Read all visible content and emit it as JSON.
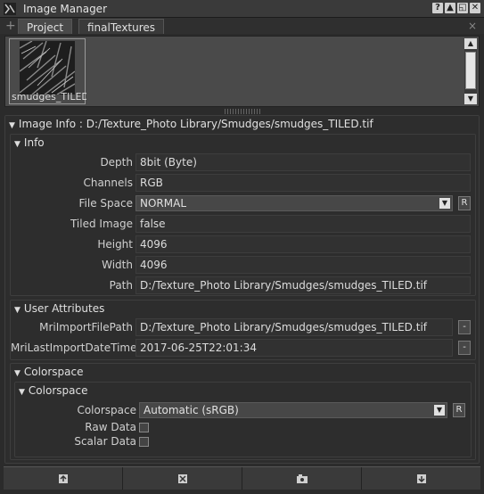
{
  "window": {
    "title": "Image Manager",
    "buttons": [
      "?",
      "▲",
      "◱",
      "✕"
    ]
  },
  "tabs": {
    "add": "+",
    "items": [
      {
        "label": "Project"
      },
      {
        "label": "finalTextures"
      }
    ],
    "close": "×"
  },
  "thumbnails": [
    {
      "label": "smudges_TILED"
    }
  ],
  "image_info": {
    "header": "Image Info : D:/Texture_Photo Library/Smudges/smudges_TILED.tif",
    "info": {
      "header": "Info",
      "depth": {
        "label": "Depth",
        "value": "8bit  (Byte)"
      },
      "channels": {
        "label": "Channels",
        "value": "RGB"
      },
      "file_space": {
        "label": "File Space",
        "value": "NORMAL",
        "reset": "R"
      },
      "tiled": {
        "label": "Tiled Image",
        "value": "false"
      },
      "height": {
        "label": "Height",
        "value": "4096"
      },
      "width": {
        "label": "Width",
        "value": "4096"
      },
      "path": {
        "label": "Path",
        "value": "D:/Texture_Photo Library/Smudges/smudges_TILED.tif"
      }
    },
    "user_attributes": {
      "header": "User Attributes",
      "import_path": {
        "label": "MriImportFilePath",
        "value": "D:/Texture_Photo Library/Smudges/smudges_TILED.tif",
        "button": "-"
      },
      "import_date": {
        "label": "MriLastImportDateTime",
        "value": "2017-06-25T22:01:34",
        "button": "-"
      }
    },
    "colorspace_outer": {
      "header": "Colorspace",
      "inner": {
        "header": "Colorspace",
        "colorspace": {
          "label": "Colorspace",
          "value": "Automatic (sRGB)",
          "reset": "R"
        },
        "raw_data": {
          "label": "Raw Data",
          "checked": false
        },
        "scalar_data": {
          "label": "Scalar Data",
          "checked": false
        }
      }
    }
  },
  "bottom_toolbar": [
    "import-icon",
    "remove-icon",
    "view-icon",
    "export-icon"
  ],
  "colors": {
    "background": "#2b2b2b",
    "field": "#313131",
    "title_bar": "#3a3a3a"
  }
}
